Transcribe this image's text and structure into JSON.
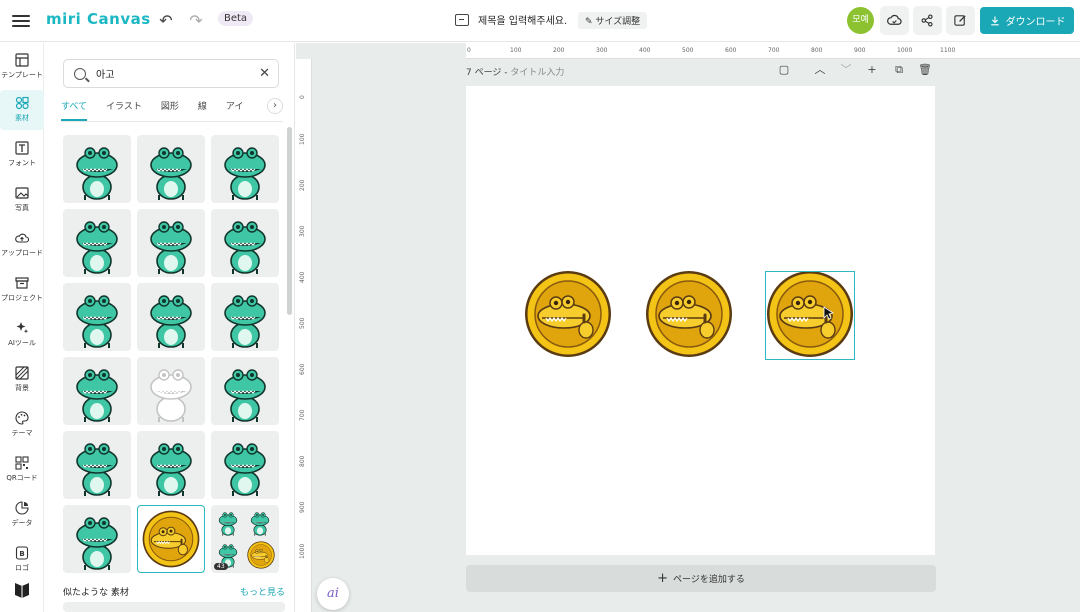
{
  "header": {
    "logo": "miri Canvas",
    "beta": "Beta",
    "title_placeholder": "제목을 입력해주세요.",
    "resize_label": "サイズ調整",
    "avatar_text": "모예",
    "download_label": "ダウンロード",
    "accent_color": "#1ba8b6"
  },
  "rail": {
    "items": [
      {
        "label": "テンプレート",
        "icon": "template-icon"
      },
      {
        "label": "素材",
        "icon": "elements-icon"
      },
      {
        "label": "フォント",
        "icon": "font-icon"
      },
      {
        "label": "写真",
        "icon": "photo-icon"
      },
      {
        "label": "アップロード",
        "icon": "upload-icon"
      },
      {
        "label": "プロジェクト",
        "icon": "project-icon"
      },
      {
        "label": "AIツール",
        "icon": "ai-tools-icon"
      },
      {
        "label": "背景",
        "icon": "background-icon"
      },
      {
        "label": "テーマ",
        "icon": "theme-icon"
      },
      {
        "label": "QRコード",
        "icon": "qr-icon"
      },
      {
        "label": "データ",
        "icon": "data-icon"
      },
      {
        "label": "ロゴ",
        "icon": "logo-icon"
      }
    ]
  },
  "panel": {
    "search_value": "아고",
    "tabs": [
      "すべて",
      "イラスト",
      "図形",
      "線",
      "アイ"
    ],
    "badge": "43",
    "similar_label": "似たような 素材",
    "more_label": "もっと見る"
  },
  "canvas": {
    "page_label": "7 ページ - ",
    "page_title_placeholder": "タイトル入力",
    "add_page_label": "ページを追加する",
    "ruler_top": [
      "0",
      "100",
      "200",
      "300",
      "400",
      "500",
      "600",
      "700",
      "800",
      "900",
      "1000",
      "1100"
    ],
    "ruler_left": [
      "0",
      "100",
      "200",
      "300",
      "400",
      "500",
      "600",
      "700",
      "800",
      "900",
      "1000"
    ]
  },
  "ai_button": "ai"
}
